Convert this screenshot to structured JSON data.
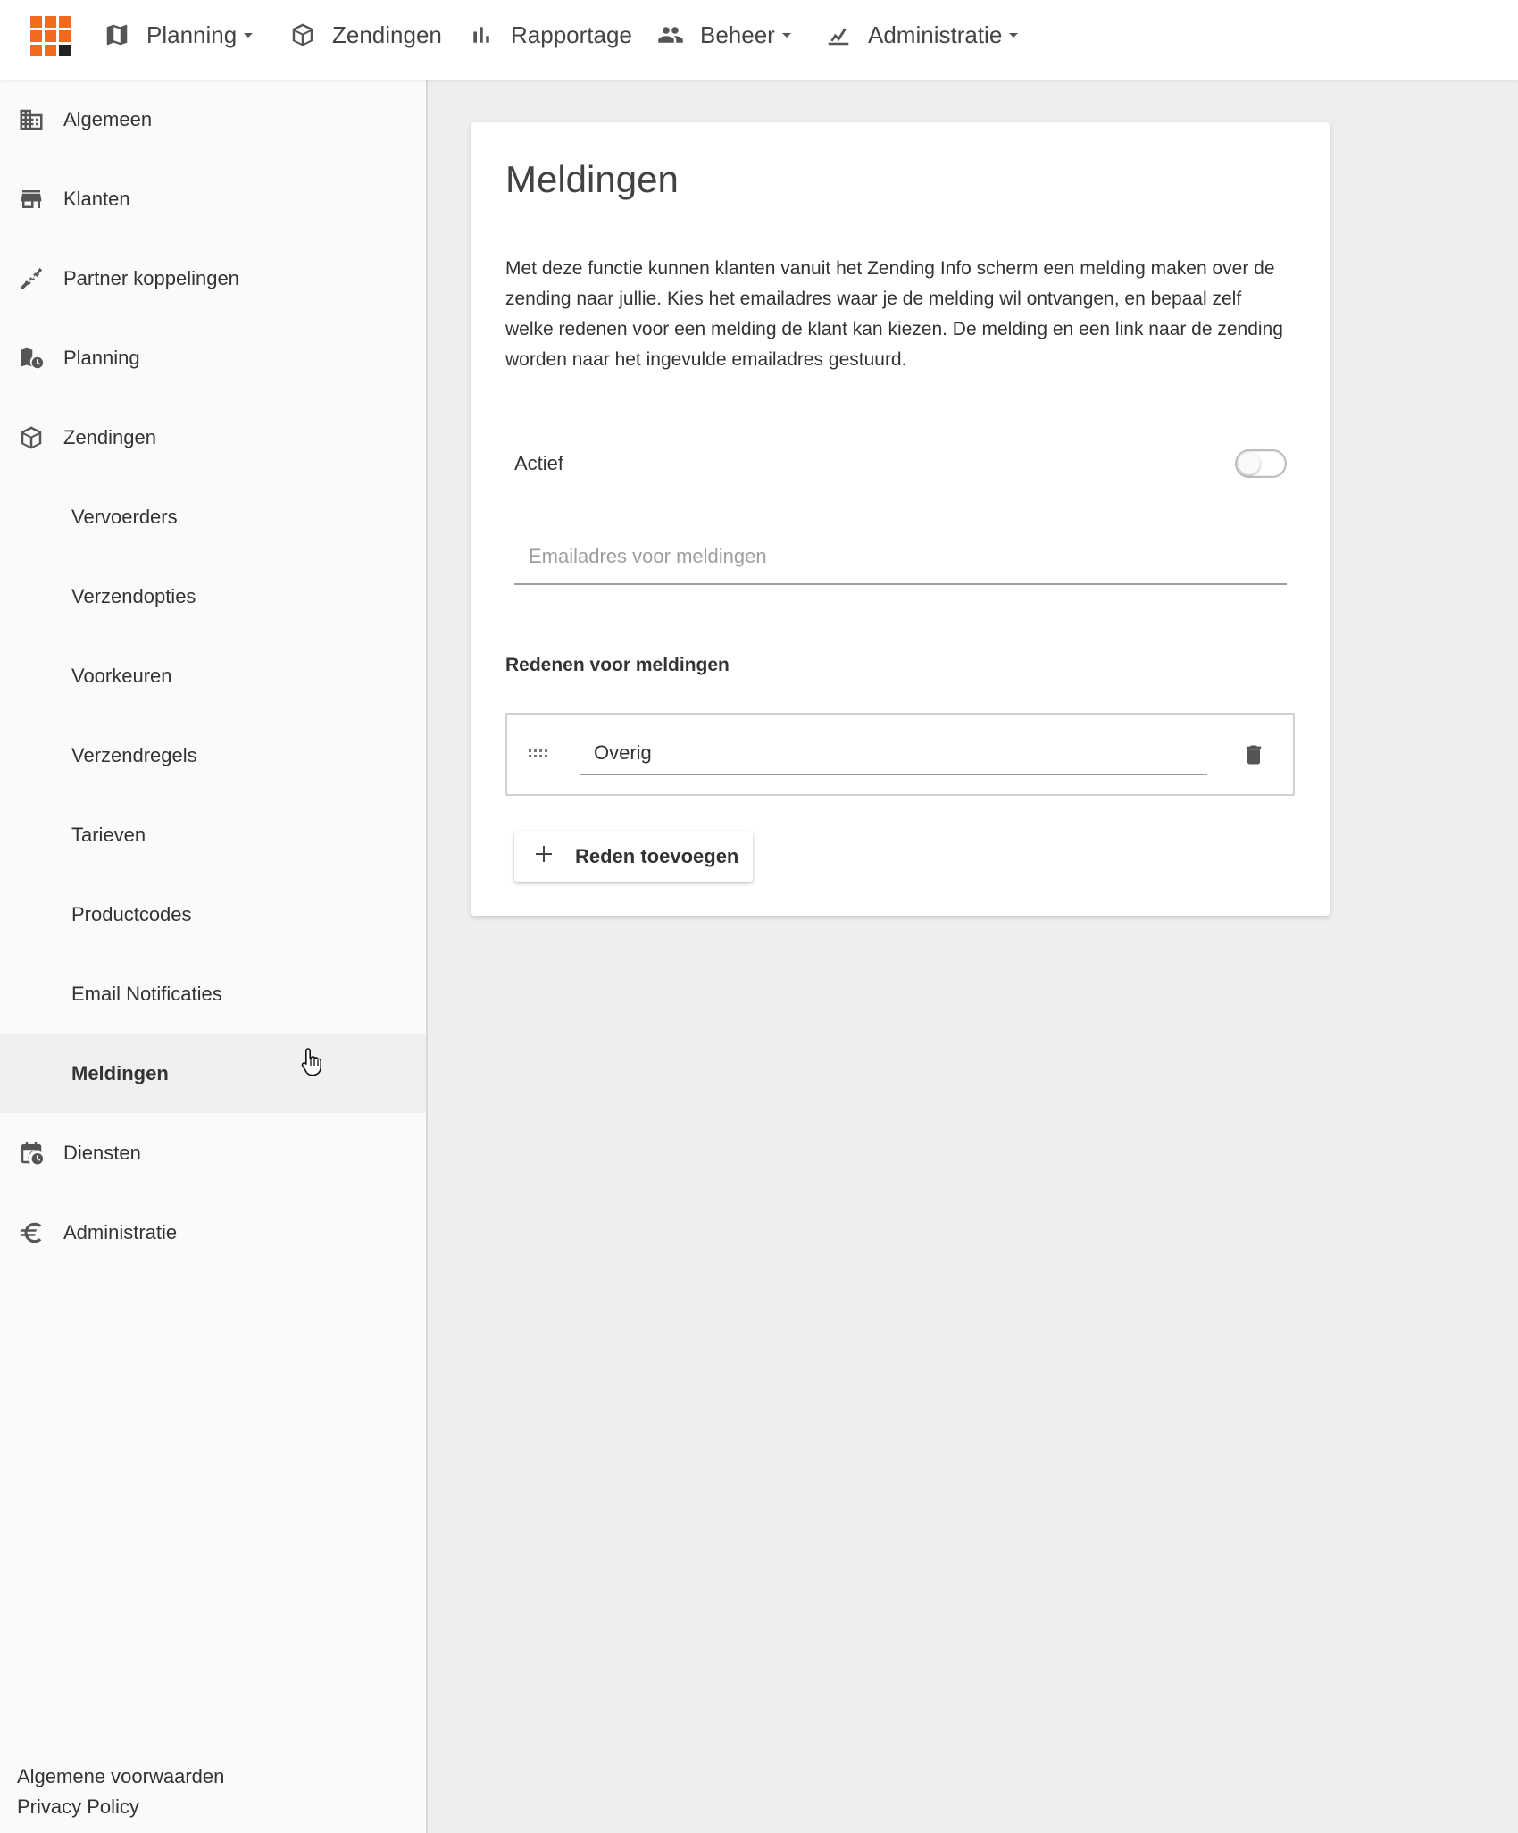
{
  "topnav": {
    "items": [
      {
        "label": "Planning",
        "icon": "map-icon",
        "dropdown": true
      },
      {
        "label": "Zendingen",
        "icon": "box-icon",
        "dropdown": false
      },
      {
        "label": "Rapportage",
        "icon": "bar-chart-icon",
        "dropdown": false
      },
      {
        "label": "Beheer",
        "icon": "people-icon",
        "dropdown": true
      },
      {
        "label": "Administratie",
        "icon": "chart-hand-icon",
        "dropdown": true
      }
    ]
  },
  "sidebar": {
    "items": [
      {
        "label": "Algemeen",
        "icon": "building-icon"
      },
      {
        "label": "Klanten",
        "icon": "store-icon"
      },
      {
        "label": "Partner koppelingen",
        "icon": "plug-icon"
      },
      {
        "label": "Planning",
        "icon": "map-clock-icon"
      },
      {
        "label": "Zendingen",
        "icon": "box-icon"
      },
      {
        "label": "Vervoerders"
      },
      {
        "label": "Verzendopties"
      },
      {
        "label": "Voorkeuren"
      },
      {
        "label": "Verzendregels"
      },
      {
        "label": "Tarieven"
      },
      {
        "label": "Productcodes"
      },
      {
        "label": "Email Notificaties"
      },
      {
        "label": "Meldingen",
        "active": true
      },
      {
        "label": "Diensten",
        "icon": "calendar-clock-icon"
      },
      {
        "label": "Administratie",
        "icon": "euro-icon"
      }
    ],
    "footer": {
      "terms": "Algemene voorwaarden",
      "privacy": "Privacy Policy"
    }
  },
  "card": {
    "title": "Meldingen",
    "description": "Met deze functie kunnen klanten vanuit het Zending Info scherm een melding maken over de zending naar jullie. Kies het emailadres waar je de melding wil ontvangen, en bepaal zelf welke redenen voor een melding de klant kan kiezen. De melding en een link naar de zending worden naar het ingevulde emailadres gestuurd.",
    "active_label": "Actief",
    "active_value": false,
    "email_placeholder": "Emailadres voor meldingen",
    "email_value": "",
    "reasons_title": "Redenen voor meldingen",
    "reasons": [
      {
        "value": "Overig"
      }
    ],
    "add_reason_label": "Reden toevoegen"
  },
  "colors": {
    "brand_orange": "#f26b1d",
    "brand_dark": "#222222",
    "background": "#eeeeee",
    "sidebar_bg": "#fafafa"
  }
}
